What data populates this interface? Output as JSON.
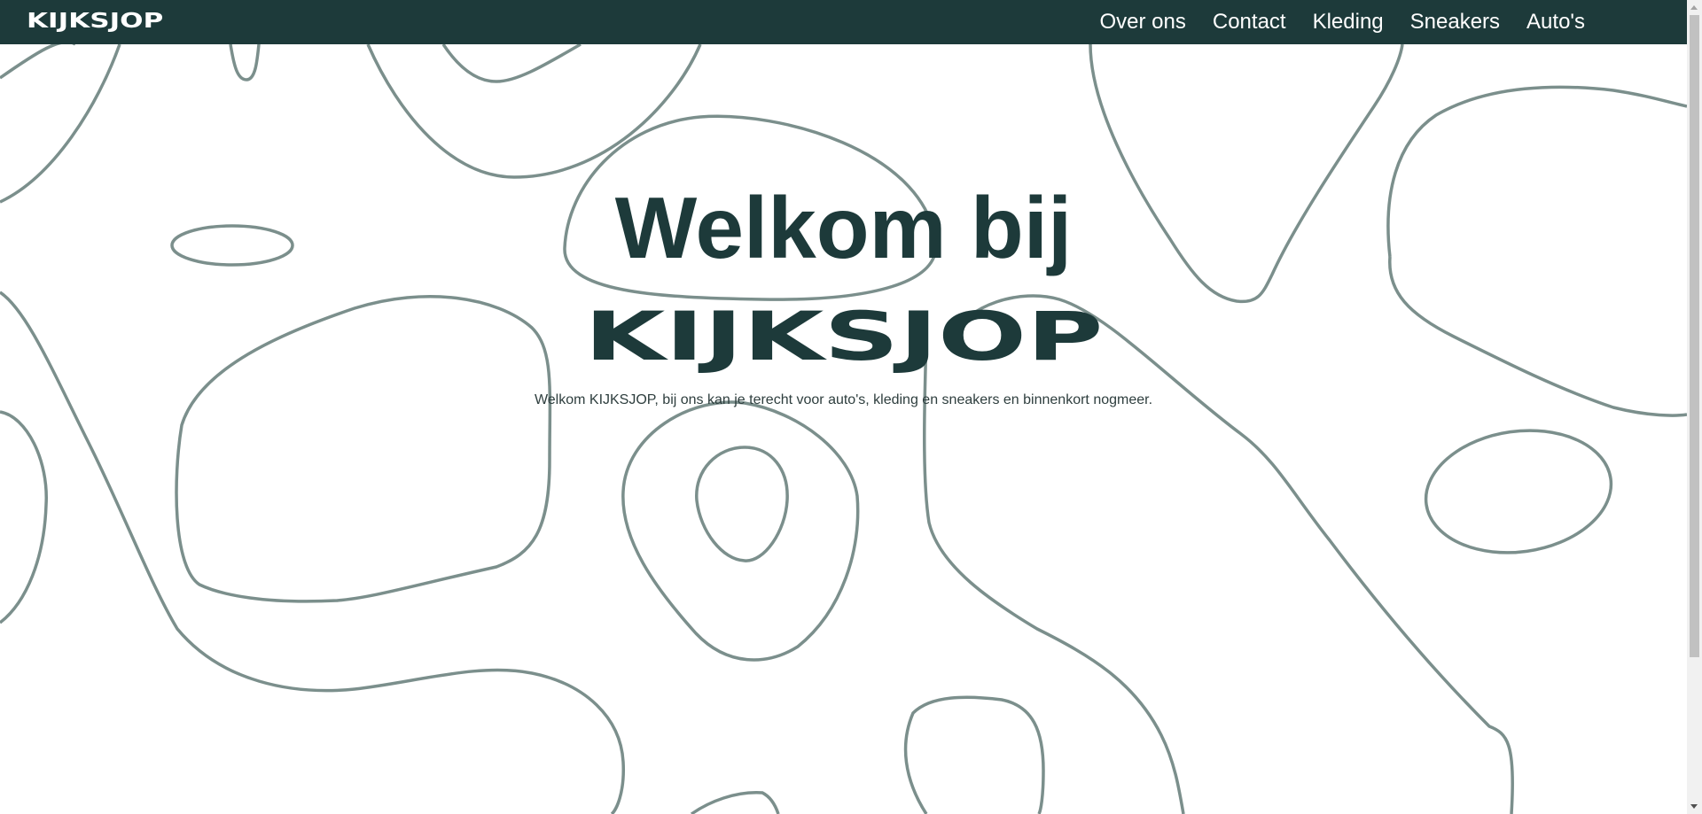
{
  "header": {
    "logo": "KIJKSJOP",
    "nav": [
      {
        "label": "Over ons"
      },
      {
        "label": "Contact"
      },
      {
        "label": "Kleding"
      },
      {
        "label": "Sneakers"
      },
      {
        "label": "Auto's"
      }
    ]
  },
  "hero": {
    "title": "Welkom bij",
    "brand": "KIJKSJOP",
    "subtitle": "Welkom KIJKSJOP, bij ons kan je terecht voor auto's, kleding en sneakers en binnenkort nogmeer."
  },
  "colors": {
    "header_bg": "#1d3a3a",
    "heading": "#1d3a3a",
    "contour_lines": "#7b8f8c",
    "background": "#ffffff"
  }
}
